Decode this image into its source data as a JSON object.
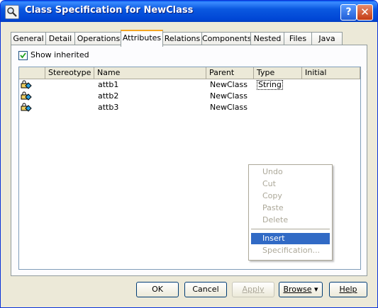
{
  "window": {
    "title": "Class Specification for NewClass",
    "help_button": "?",
    "close_button": "✕"
  },
  "tabs": [
    {
      "label": "General"
    },
    {
      "label": "Detail"
    },
    {
      "label": "Operations"
    },
    {
      "label": "Attributes",
      "active": true
    },
    {
      "label": "Relations"
    },
    {
      "label": "Components"
    },
    {
      "label": "Nested"
    },
    {
      "label": "Files"
    },
    {
      "label": "Java"
    }
  ],
  "show_inherited": {
    "label": "Show inherited",
    "checked": true
  },
  "attributes_table": {
    "columns": [
      "",
      "Stereotype",
      "Name",
      "Parent",
      "Type",
      "Initial"
    ],
    "rows": [
      {
        "icon": "attribute-icon",
        "stereotype": "",
        "name": "attb1",
        "parent": "NewClass",
        "type": "String",
        "initial": ""
      },
      {
        "icon": "attribute-icon",
        "stereotype": "",
        "name": "attb2",
        "parent": "NewClass",
        "type": "",
        "initial": ""
      },
      {
        "icon": "attribute-icon",
        "stereotype": "",
        "name": "attb3",
        "parent": "NewClass",
        "type": "",
        "initial": ""
      }
    ]
  },
  "context_menu": {
    "items": [
      {
        "label": "Undo",
        "enabled": false
      },
      {
        "label": "Cut",
        "enabled": false
      },
      {
        "label": "Copy",
        "enabled": false
      },
      {
        "label": "Paste",
        "enabled": false
      },
      {
        "label": "Delete",
        "enabled": false
      },
      {
        "label": "Insert",
        "enabled": true,
        "highlighted": true
      },
      {
        "label": "Specification...",
        "enabled": false
      }
    ]
  },
  "buttons": {
    "ok": "OK",
    "cancel": "Cancel",
    "apply": "Apply",
    "browse": "Browse",
    "help": "Help"
  },
  "colors": {
    "titlebar": "#0a58e0",
    "menu_highlight": "#316ac5",
    "active_tab_accent": "#f5a623",
    "dialog_face": "#ece9d8"
  }
}
